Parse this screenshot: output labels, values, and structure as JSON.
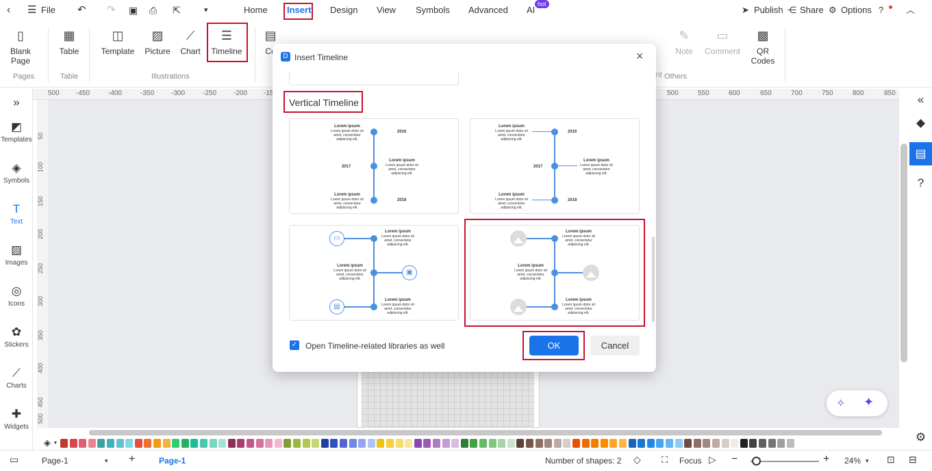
{
  "topbar": {
    "file": "File",
    "tabs": [
      "Home",
      "Insert",
      "Design",
      "View",
      "Symbols",
      "Advanced",
      "AI"
    ],
    "hot_badge": "hot",
    "publish": "Publish",
    "share": "Share",
    "options": "Options"
  },
  "ribbon": {
    "blank_page": "Blank Page",
    "table": "Table",
    "template": "Template",
    "picture": "Picture",
    "chart": "Chart",
    "timeline": "Timeline",
    "partial_co": "Co",
    "partial_nt": "nt",
    "note": "Note",
    "comment": "Comment",
    "qr_codes": "QR Codes",
    "groups": {
      "pages": "Pages",
      "table": "Table",
      "illustrations": "Illustrations",
      "others": "Others"
    }
  },
  "leftbar": [
    "Templates",
    "Symbols",
    "Text",
    "Images",
    "Icons",
    "Stickers",
    "Charts",
    "Widgets"
  ],
  "ruler_top": [
    "500",
    "-450",
    "-400",
    "-350",
    "-300",
    "-250",
    "-200",
    "-150",
    "500",
    "550",
    "600",
    "650",
    "700",
    "750",
    "800",
    "850"
  ],
  "ruler_left": [
    "50",
    "100",
    "150",
    "200",
    "250",
    "300",
    "350",
    "400",
    "450",
    "500"
  ],
  "dialog": {
    "title": "Insert Timeline",
    "section": "Vertical Timeline",
    "lorem_title": "Lorem ipsum",
    "lorem_body": "Lorem ipsum dolor sit amet, consectetur adipiscing elit.",
    "years": [
      "2016",
      "2017",
      "2018"
    ],
    "checkbox_label": "Open Timeline-related libraries as well",
    "checkbox_checked": true,
    "ok": "OK",
    "cancel": "Cancel"
  },
  "statusbar": {
    "page_select": "Page-1",
    "page_tab": "Page-1",
    "shapes": "Number of shapes: 2",
    "focus": "Focus",
    "zoom": "24%"
  },
  "colors": {
    "accent": "#1a73e8",
    "highlight_red": "#c8102e",
    "timeline_blue": "#4a90e2",
    "palette": [
      "#c0392b",
      "#d64550",
      "#e06070",
      "#f08090",
      "#3aa0a0",
      "#40b0c0",
      "#60c0d0",
      "#80d8e0",
      "#e74c3c",
      "#f07030",
      "#f39c12",
      "#f5b041",
      "#2ecc71",
      "#27ae60",
      "#1abc9c",
      "#48c9b0",
      "#76d7c4",
      "#a3e4d7",
      "#8e2d5a",
      "#a93c72",
      "#c2558a",
      "#d770a0",
      "#e895bb",
      "#f3b6d0",
      "#7fa030",
      "#98b840",
      "#b0c850",
      "#c8d870",
      "#2040a0",
      "#3050c0",
      "#5068d0",
      "#7088e0",
      "#90a8f0",
      "#b0c4f8",
      "#f1c40f",
      "#f4d03f",
      "#f7dc6f",
      "#fae69a",
      "#8e44ad",
      "#9b59b6",
      "#af7ac5",
      "#c39bd3",
      "#d7bde2",
      "#2e7d32",
      "#43a047",
      "#66bb6a",
      "#81c784",
      "#a5d6a7",
      "#c8e6c9",
      "#5d4037",
      "#795548",
      "#8d6e63",
      "#a1887f",
      "#bcaaa4",
      "#d7ccc8",
      "#e65100",
      "#ef6c00",
      "#f57c00",
      "#fb8c00",
      "#ffa726",
      "#ffb74d",
      "#1565c0",
      "#1976d2",
      "#1e88e5",
      "#42a5f5",
      "#64b5f6",
      "#90caf9",
      "#6d4c41",
      "#8d6e63",
      "#a1887f",
      "#bcaaa4",
      "#d7ccc8",
      "#efebe9",
      "#212121",
      "#424242",
      "#616161",
      "#757575",
      "#9e9e9e",
      "#bdbdbd"
    ]
  }
}
